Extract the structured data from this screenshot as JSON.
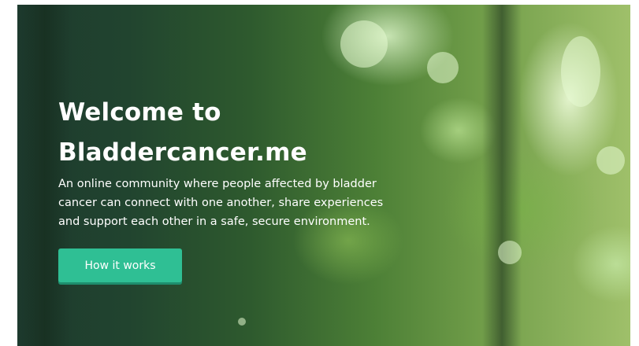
{
  "hero": {
    "title_line1": "Welcome to",
    "title_line2": "Bladdercancer.me",
    "description_line1": "An online community where people affected by bladder",
    "description_line2": "cancer can connect with one another, share experiences",
    "description_line3": "and support each other in a safe, secure environment.",
    "cta_label": "How it works"
  },
  "colors": {
    "cta_background": "#2fbf94",
    "text": "#ffffff",
    "page_background": "#ffffff"
  }
}
